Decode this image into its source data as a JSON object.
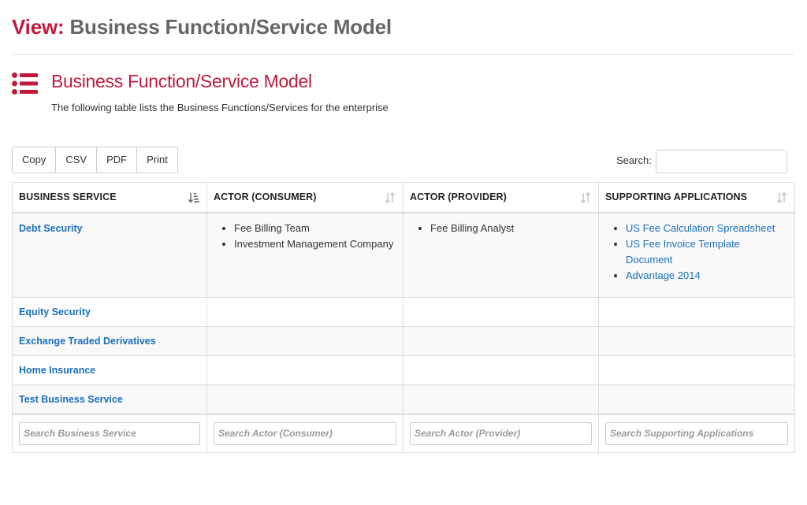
{
  "header": {
    "view_prefix": "View:",
    "view_name": "Business Function/Service Model"
  },
  "section": {
    "icon": "list-icon",
    "title": "Business Function/Service Model",
    "description": "The following table lists the Business Functions/Services for the enterprise"
  },
  "toolbar": {
    "buttons": [
      "Copy",
      "CSV",
      "PDF",
      "Print"
    ],
    "search_label": "Search:",
    "search_value": ""
  },
  "table": {
    "columns": [
      "BUSINESS SERVICE",
      "ACTOR (CONSUMER)",
      "ACTOR (PROVIDER)",
      "SUPPORTING APPLICATIONS"
    ],
    "sort": [
      "sorted-ascending-icon",
      "sortable-icon",
      "sortable-icon",
      "sortable-icon"
    ],
    "rows": [
      {
        "service": "Debt Security",
        "consumers": [
          "Fee Billing Team",
          "Investment Management Company"
        ],
        "providers": [
          "Fee Billing Analyst"
        ],
        "applications": [
          "US Fee Calculation Spreadsheet",
          "US Fee Invoice Template Document",
          "Advantage 2014"
        ]
      },
      {
        "service": "Equity Security",
        "consumers": [],
        "providers": [],
        "applications": []
      },
      {
        "service": "Exchange Traded Derivatives",
        "consumers": [],
        "providers": [],
        "applications": []
      },
      {
        "service": "Home Insurance",
        "consumers": [],
        "providers": [],
        "applications": []
      },
      {
        "service": "Test Business Service",
        "consumers": [],
        "providers": [],
        "applications": []
      }
    ],
    "footer_placeholders": [
      "Search Business Service",
      "Search Actor (Consumer)",
      "Search Actor (Provider)",
      "Search Supporting Applications"
    ]
  },
  "colors": {
    "accent": "#c3193c",
    "link": "#1a6fbd",
    "muted_heading": "#666666"
  }
}
